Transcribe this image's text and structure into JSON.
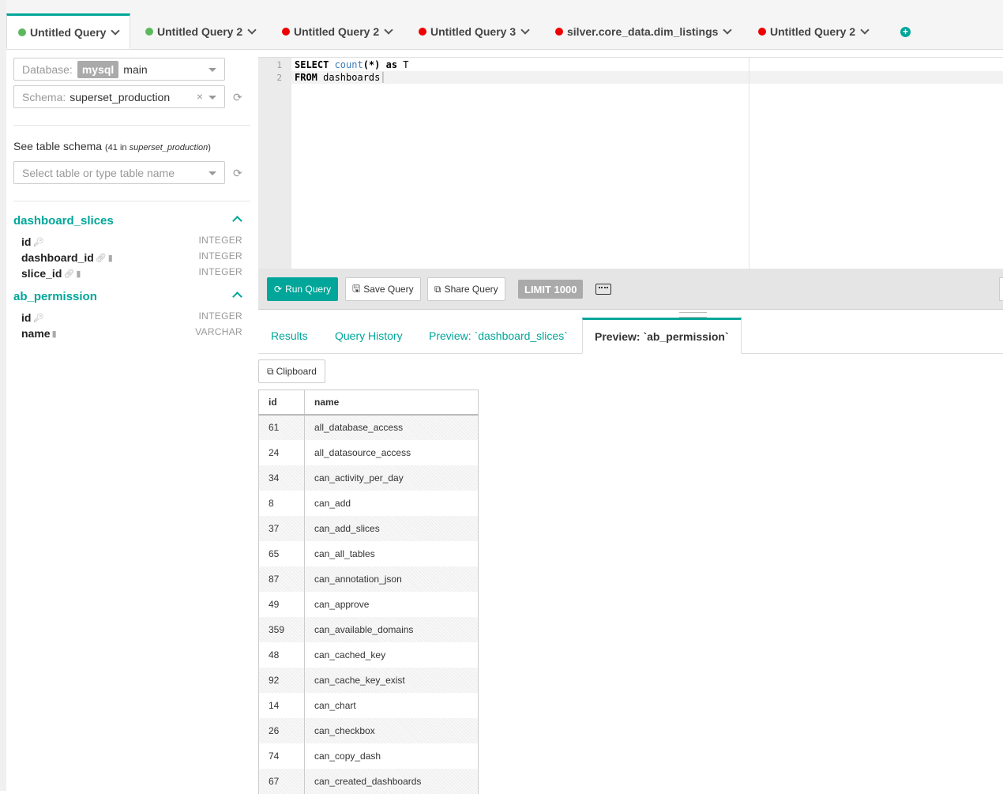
{
  "tabs": [
    {
      "label": "Untitled Query",
      "status": "green",
      "active": true
    },
    {
      "label": "Untitled Query 2",
      "status": "green"
    },
    {
      "label": "Untitled Query 2",
      "status": "red"
    },
    {
      "label": "Untitled Query 3",
      "status": "red"
    },
    {
      "label": "silver.core_data.dim_listings",
      "status": "red"
    },
    {
      "label": "Untitled Query 2",
      "status": "red"
    }
  ],
  "sidebar": {
    "database_label": "Database:",
    "database_engine": "mysql",
    "database_name": "main",
    "schema_label": "Schema:",
    "schema_value": "superset_production",
    "schema_clear": "×",
    "see_schema": "See table schema",
    "table_count": "41",
    "table_count_in": "in",
    "table_count_schema": "superset_production",
    "table_placeholder": "Select table or type table name",
    "tables": [
      {
        "name": "dashboard_slices",
        "columns": [
          {
            "name": "id",
            "type": "INTEGER"
          },
          {
            "name": "dashboard_id",
            "type": "INTEGER"
          },
          {
            "name": "slice_id",
            "type": "INTEGER"
          }
        ]
      },
      {
        "name": "ab_permission",
        "columns": [
          {
            "name": "id",
            "type": "INTEGER"
          },
          {
            "name": "name",
            "type": "VARCHAR"
          }
        ]
      }
    ]
  },
  "editor": {
    "line_numbers": [
      "1",
      "2"
    ],
    "line1_select": "SELECT ",
    "line1_fn": "count",
    "line1_rest": "(*) ",
    "line1_as": "as",
    "line1_alias": " T",
    "line2_from": "FROM",
    "line2_table": " dashboards"
  },
  "toolbar": {
    "run": "Run Query",
    "save": "Save Query",
    "share": "Share Query",
    "limit": "LIMIT 1000"
  },
  "result_tabs": {
    "results": "Results",
    "history": "Query History",
    "preview1": "Preview: `dashboard_slices`",
    "preview2": "Preview: `ab_permission`"
  },
  "clipboard": "Clipboard",
  "table": {
    "headers": [
      "id",
      "name"
    ],
    "rows": [
      [
        "61",
        "all_database_access"
      ],
      [
        "24",
        "all_datasource_access"
      ],
      [
        "34",
        "can_activity_per_day"
      ],
      [
        "8",
        "can_add"
      ],
      [
        "37",
        "can_add_slices"
      ],
      [
        "65",
        "can_all_tables"
      ],
      [
        "87",
        "can_annotation_json"
      ],
      [
        "49",
        "can_approve"
      ],
      [
        "359",
        "can_available_domains"
      ],
      [
        "48",
        "can_cached_key"
      ],
      [
        "92",
        "can_cache_key_exist"
      ],
      [
        "14",
        "can_chart"
      ],
      [
        "26",
        "can_checkbox"
      ],
      [
        "74",
        "can_copy_dash"
      ],
      [
        "67",
        "can_created_dashboards"
      ]
    ]
  },
  "colors": {
    "accent": "#00a699",
    "status_ok": "#5cb85c",
    "status_err": "#ee0000"
  }
}
